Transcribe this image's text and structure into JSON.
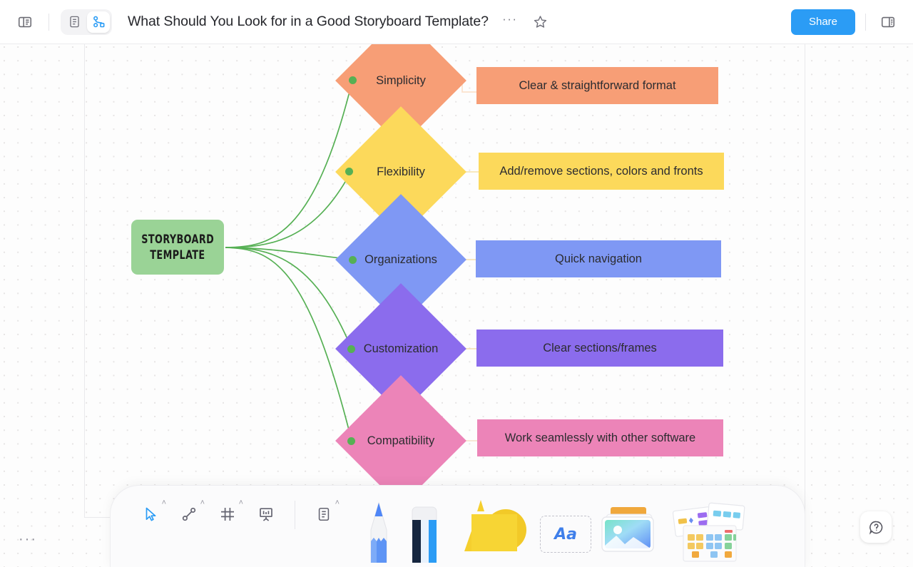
{
  "topbar": {
    "left_panel_icon": "panel-left-icon",
    "mode_doc_icon": "document-icon",
    "mode_board_icon": "mindmap-icon",
    "title": "What Should You Look for in a Good Storyboard Template?",
    "more_label": "···",
    "star_icon": "star-icon",
    "share_label": "Share",
    "right_panel_icon": "panel-right-icon"
  },
  "canvas": {
    "root_node": {
      "line1": "STORYBOARD",
      "line2": "TEMPLATE",
      "color": "#9ad396"
    },
    "branches": [
      {
        "label": "Simplicity",
        "diamond_color": "#f79e76",
        "box_text": "Clear & straightforward format",
        "box_color": "#f79e76",
        "connector_color": "#fae0cf"
      },
      {
        "label": "Flexibility",
        "diamond_color": "#fcd95b",
        "box_text": "Add/remove sections, colors and fronts",
        "box_color": "#fcd95b",
        "connector_color": "#f8e7b4"
      },
      {
        "label": "Organizations",
        "diamond_color": "#7f98f4",
        "box_text": "Quick navigation",
        "box_color": "#7f98f4",
        "connector_color": "#f5e3b9"
      },
      {
        "label": "Customization",
        "diamond_color": "#8b6ced",
        "box_text": "Clear sections/frames",
        "box_color": "#8b6ced",
        "connector_color": "#f5e3b9"
      },
      {
        "label": "Compatibility",
        "diamond_color": "#ec84b8",
        "box_text": "Work seamlessly with other software",
        "box_color": "#ec84b8",
        "connector_color": "#f7e7d2"
      }
    ],
    "edge_color": "#56b054"
  },
  "toolbar": {
    "tools": [
      {
        "name": "select-tool",
        "icon": "cursor-icon",
        "caret": "˄",
        "active": true
      },
      {
        "name": "connector-tool",
        "icon": "connector-line-icon",
        "caret": "˄",
        "active": false
      },
      {
        "name": "frame-tool",
        "icon": "frame-icon",
        "caret": "˄",
        "active": false
      },
      {
        "name": "presentation-tool",
        "icon": "easel-icon",
        "caret": "",
        "active": false
      },
      {
        "name": "doc-tool",
        "icon": "document-icon",
        "caret": "˄",
        "active": false
      }
    ],
    "big_tools": [
      {
        "name": "pen-tool",
        "icon": "pencil-icon"
      },
      {
        "name": "eraser-tool",
        "icon": "eraser-icon"
      },
      {
        "name": "sticky-note-tool",
        "icon": "sticky-note-icon"
      },
      {
        "name": "text-tool",
        "icon": "text-aa-icon",
        "label": "Aa"
      },
      {
        "name": "image-tool",
        "icon": "image-icon"
      },
      {
        "name": "template-tool",
        "icon": "templates-icon"
      }
    ]
  },
  "footer": {
    "corner_dots": "···",
    "help_icon": "help-question-icon"
  }
}
